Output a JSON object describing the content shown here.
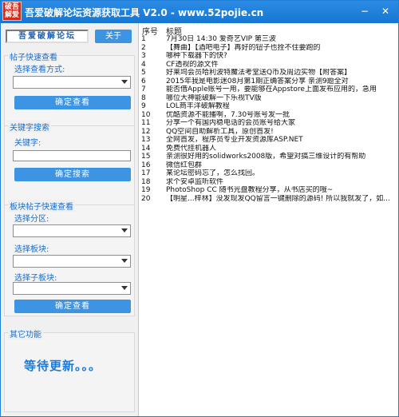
{
  "window": {
    "logo_text": "破吾解爱",
    "title": "吾爱破解论坛资源获取工具 V2.0 - www.52pojie.cn",
    "minimize_glyph": "−",
    "close_glyph": "✕"
  },
  "left": {
    "tab_label": "吾爱破解论坛",
    "about_label": "关于",
    "quick_view": {
      "group_title": "帖子快速查看",
      "label": "选择查看方式:",
      "select_value": "",
      "button": "确定查看"
    },
    "keyword_search": {
      "group_title": "关键字搜索",
      "label": "关键字:",
      "input_value": "",
      "button": "确定搜索"
    },
    "board_view": {
      "group_title": "板块帖子快速查看",
      "partition_label": "选择分区:",
      "partition_value": "",
      "board_label": "选择板块:",
      "board_value": "",
      "subboard_label": "选择子板块:",
      "subboard_value": "",
      "button": "确定查看"
    },
    "other": {
      "group_title": "其它功能",
      "message": "等待更新。。。"
    }
  },
  "list": {
    "col_no": "序号",
    "col_title": "标题",
    "rows": [
      {
        "no": "1",
        "title": "7月30日 14:30  爱奇艺VIP 第三波"
      },
      {
        "no": "2",
        "title": "【舞曲】【酒吧电子】再好的钮子也拴不住要跑的"
      },
      {
        "no": "3",
        "title": "哪种下载器下的快?"
      },
      {
        "no": "4",
        "title": "CF透视的源文件"
      },
      {
        "no": "5",
        "title": "好莱坞会员哈利波特魔法考堂送Q币及周边实物【附答案】"
      },
      {
        "no": "6",
        "title": "2015年我是电影迷08月第1期正确答案分享 亲测9题全对"
      },
      {
        "no": "7",
        "title": "能否借Apple账号一用，要能够在Appstore上面发布应用的，急用"
      },
      {
        "no": "8",
        "title": "哪位大神能破解一下乐视TV版"
      },
      {
        "no": "9",
        "title": "LOL商丰洋破解教程"
      },
      {
        "no": "10",
        "title": "优酷资源不能播啊，7.30号账号发一批"
      },
      {
        "no": "11",
        "title": "分享一个有国内稳电话的会员账号给大家"
      },
      {
        "no": "12",
        "title": "QQ空间自助解析工具，原创首发!"
      },
      {
        "no": "13",
        "title": "全网首发，程序员专业开发资源库ASP.NET"
      },
      {
        "no": "14",
        "title": "免费代挂机器人"
      },
      {
        "no": "15",
        "title": "亲测很好用的solidworks2008版，希望对搞三维设计的有帮助"
      },
      {
        "no": "16",
        "title": "微信红包群"
      },
      {
        "no": "17",
        "title": "某论坛密码忘了，怎么找回。"
      },
      {
        "no": "18",
        "title": "求个安卓监听软件"
      },
      {
        "no": "19",
        "title": "PhotoShop CC 随书光盘教程分享，从书店买的哦~"
      },
      {
        "no": "20",
        "title": "【明星...梓林】没发现发QQ留言一键删除的源码! 所以我就发了，如..."
      }
    ]
  },
  "colors": {
    "titlebar": "#1577d2",
    "button": "#3d94e3",
    "group_title": "#1a6dc8",
    "waiting_text": "#1c7bd8"
  }
}
